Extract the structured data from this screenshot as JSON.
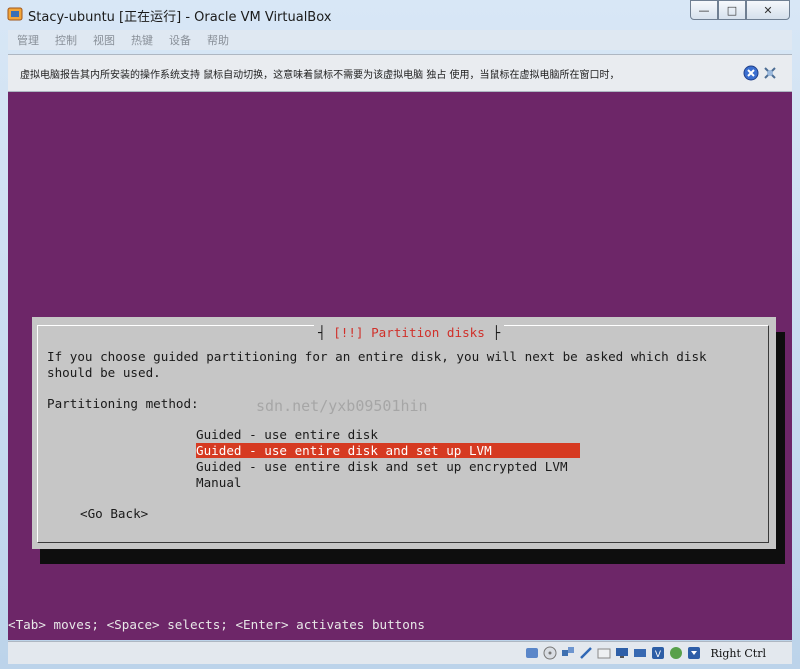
{
  "window": {
    "title": "Stacy-ubuntu [正在运行] - Oracle VM VirtualBox",
    "buttons": {
      "minimize": "—",
      "maximize": "□",
      "close": "✕"
    }
  },
  "menu": [
    "管理",
    "控制",
    "视图",
    "热键",
    "设备",
    "帮助"
  ],
  "notice": {
    "text": "虚拟电脑报告其内所安装的操作系统支持 鼠标自动切换，这意味着鼠标不需要为该虚拟电脑 独占 使用，当鼠标在虚拟电脑所在窗口时，"
  },
  "dialog": {
    "title_left": "┤",
    "title": "[!!] Partition disks",
    "title_right": "├",
    "intro_line1": "If you choose guided partitioning for an entire disk, you will next be asked which disk",
    "intro_line2": "should be used.",
    "method_label": "Partitioning method:",
    "options": [
      "Guided - use entire disk",
      "Guided - use entire disk and set up LVM",
      "Guided - use entire disk and set up encrypted LVM",
      "Manual"
    ],
    "selected_index": 1,
    "back_label": "<Go Back>"
  },
  "help_line": "<Tab> moves; <Space> selects; <Enter> activates buttons",
  "watermark": "sdn.net/yxb09501hin",
  "statusbar": {
    "host_key": "Right Ctrl"
  },
  "colors": {
    "screen_bg": "#6d2668",
    "dialog_bg": "#c6c6c6",
    "selected_bg": "#d63a21",
    "title_red": "#d0302a"
  }
}
